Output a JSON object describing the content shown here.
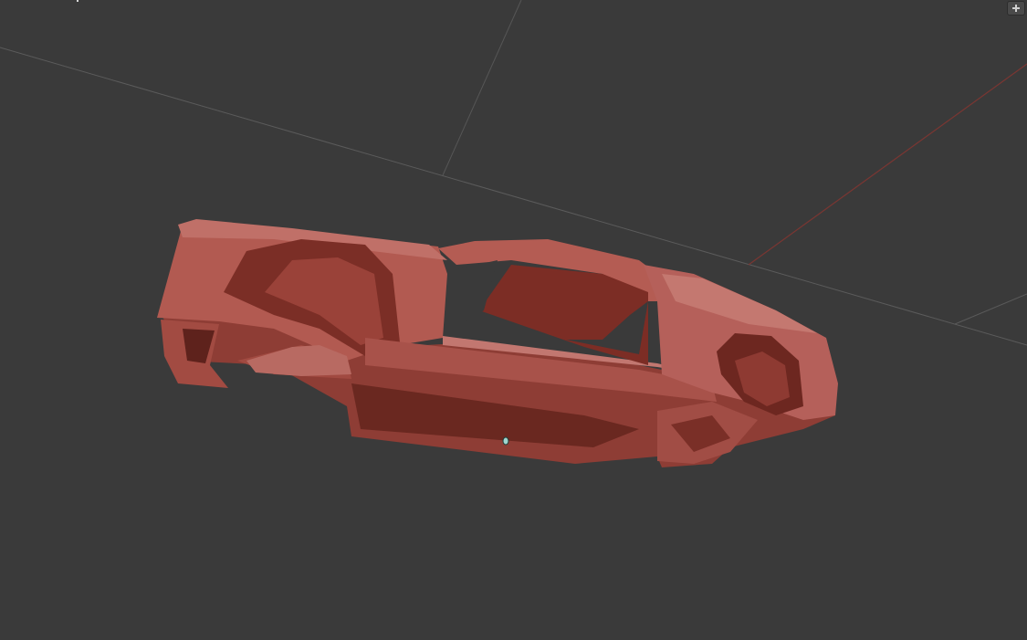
{
  "viewport": {
    "background": "#3a3a3a",
    "grid_color": "#5a5a5a",
    "x_axis_color": "#8a3a36",
    "model_color": "#b2574f",
    "model_dark": "#6e2a24",
    "model_light": "#c77a72"
  },
  "overlay": {
    "corner_button_icon": "plus-icon",
    "origin_marker_icon": "cursor-marker-icon"
  }
}
